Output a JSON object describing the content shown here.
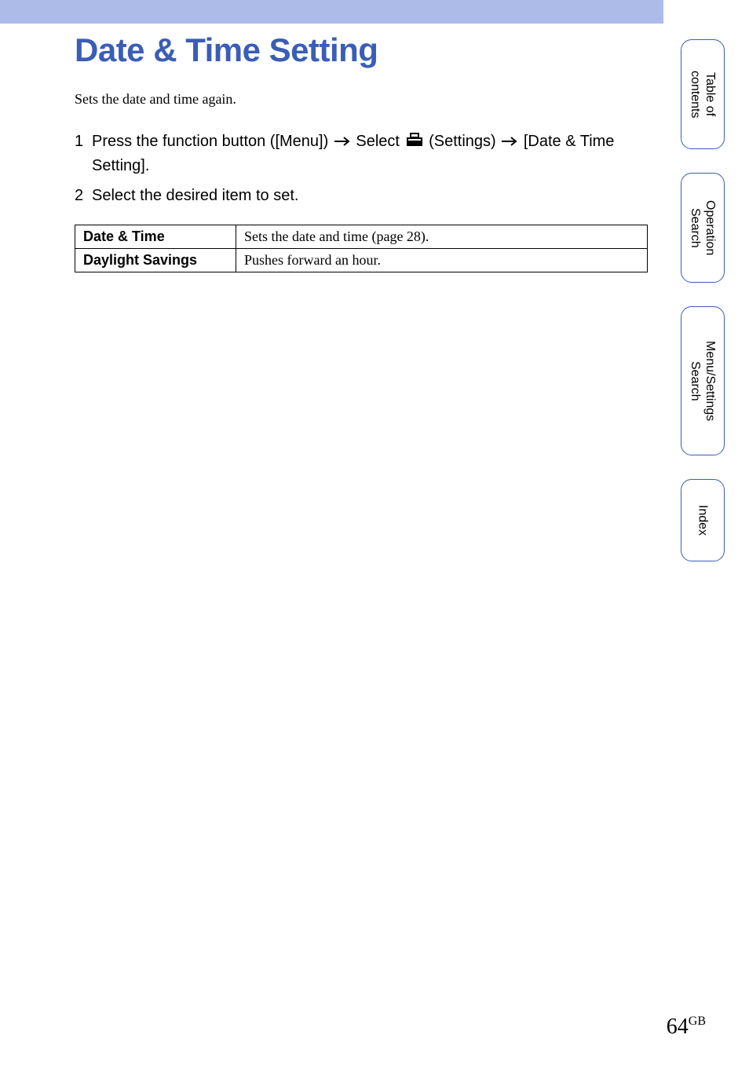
{
  "title": "Date & Time Setting",
  "intro": "Sets the date and time again.",
  "steps": [
    {
      "num": "1",
      "prefix": "Press the function button ([Menu]) ",
      "mid": " Select ",
      "settings_word": " (Settings) ",
      "suffix": " [Date & Time Setting]."
    },
    {
      "num": "2",
      "prefix": "Select the desired item to set."
    }
  ],
  "table": {
    "rows": [
      {
        "label": "Date & Time",
        "desc": "Sets the date and time (page 28)."
      },
      {
        "label": "Daylight Savings",
        "desc": "Pushes forward an hour."
      }
    ]
  },
  "side_tabs": [
    "Table of contents",
    "Operation Search",
    "Menu/Settings Search",
    "Index"
  ],
  "page_number": "64",
  "page_suffix": "GB"
}
